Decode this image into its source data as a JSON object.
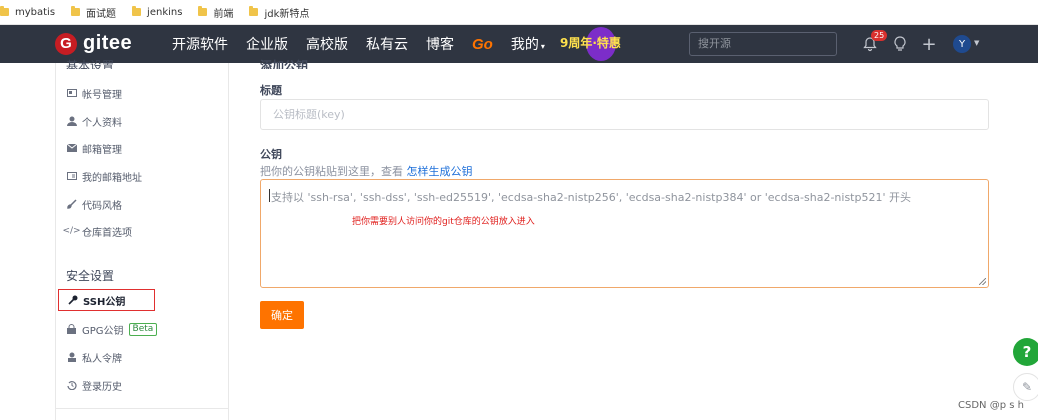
{
  "bookmarks": [
    "mybatis",
    "面试题",
    "jenkins",
    "前端",
    "jdk新特点"
  ],
  "header": {
    "logo_text": "gitee",
    "logo_mark": "G",
    "nav": [
      "开源软件",
      "企业版",
      "高校版",
      "私有云",
      "博客",
      "Go",
      "我的"
    ],
    "promo_text": "9周年·特惠",
    "search_placeholder": "搜开源",
    "notification_count": "25",
    "avatar_letter": "Y"
  },
  "sidebar": {
    "basic_heading": "基本设置",
    "basic_items": [
      {
        "label": "帐号管理",
        "icon": "id-card-icon"
      },
      {
        "label": "个人资料",
        "icon": "user-icon"
      },
      {
        "label": "邮箱管理",
        "icon": "envelope-icon"
      },
      {
        "label": "我的邮箱地址",
        "icon": "address-card-icon"
      },
      {
        "label": "代码风格",
        "icon": "brush-icon"
      },
      {
        "label": "仓库首选项",
        "icon": "code-icon"
      }
    ],
    "security_heading": "安全设置",
    "security_items": [
      {
        "label": "SSH公钥",
        "icon": "key-icon"
      },
      {
        "label": "GPG公钥",
        "icon": "lock-icon",
        "badge": "Beta"
      },
      {
        "label": "私人令牌",
        "icon": "people-icon"
      },
      {
        "label": "登录历史",
        "icon": "history-icon"
      }
    ]
  },
  "form": {
    "heading": "添加公钥",
    "title_label": "标题",
    "title_placeholder": "公钥标题(key)",
    "key_label": "公钥",
    "key_hint": "把你的公钥粘贴到这里，查看",
    "key_hint_link": "怎样生成公钥",
    "key_placeholder": "支持以 'ssh-rsa', 'ssh-dss', 'ssh-ed25519', 'ecdsa-sha2-nistp256', 'ecdsa-sha2-nistp384' or 'ecdsa-sha2-nistp521' 开头",
    "annotation": "把你需要别人访问你的git仓库的公钥放入进入",
    "confirm_label": "确定"
  },
  "floating": {
    "help": "?",
    "edit": "✎"
  },
  "watermark": "CSDN @p s h",
  "colors": {
    "accent": "#fe7300",
    "brand": "#c71d23",
    "header_bg": "#2f3541",
    "help_green": "#22a639",
    "highlight_red": "#e02f2f"
  }
}
